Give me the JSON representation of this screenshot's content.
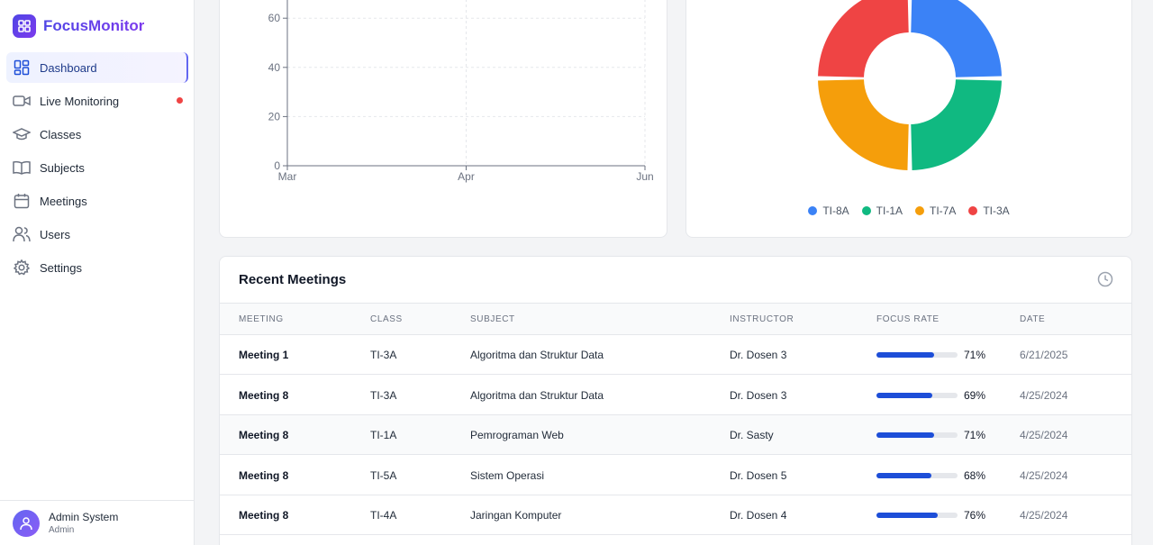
{
  "brand": {
    "name": "FocusMonitor"
  },
  "sidebar": {
    "items": [
      {
        "label": "Dashboard",
        "icon": "dashboard-icon",
        "active": true
      },
      {
        "label": "Live Monitoring",
        "icon": "video-icon",
        "live": true
      },
      {
        "label": "Classes",
        "icon": "graduation-cap-icon"
      },
      {
        "label": "Subjects",
        "icon": "book-icon"
      },
      {
        "label": "Meetings",
        "icon": "calendar-icon"
      },
      {
        "label": "Users",
        "icon": "users-icon"
      },
      {
        "label": "Settings",
        "icon": "gear-icon"
      }
    ],
    "user": {
      "name": "Admin System",
      "role": "Admin"
    }
  },
  "line_chart": {
    "chart_data": {
      "type": "line",
      "x_ticks": [
        "Mar",
        "Apr",
        "Jun"
      ],
      "y_ticks": [
        0,
        20,
        40,
        60
      ],
      "ylim": [
        0,
        80
      ],
      "grid": true,
      "series": []
    }
  },
  "pie_chart": {
    "chart_data": {
      "type": "pie",
      "labels": [
        "TI-8A",
        "TI-1A",
        "TI-7A",
        "TI-3A"
      ],
      "values": [
        25,
        25,
        25,
        25
      ],
      "colors": [
        "#3b82f6",
        "#10b981",
        "#f59e0b",
        "#ef4444"
      ],
      "legend": "bottom"
    }
  },
  "meetings": {
    "title": "Recent Meetings",
    "columns": [
      "MEETING",
      "CLASS",
      "SUBJECT",
      "INSTRUCTOR",
      "FOCUS RATE",
      "DATE"
    ],
    "rows": [
      {
        "meeting": "Meeting 1",
        "class": "TI-3A",
        "subject": "Algoritma dan Struktur Data",
        "instructor": "Dr. Dosen 3",
        "focus": 71,
        "focus_label": "71%",
        "date": "6/21/2025"
      },
      {
        "meeting": "Meeting 8",
        "class": "TI-3A",
        "subject": "Algoritma dan Struktur Data",
        "instructor": "Dr. Dosen 3",
        "focus": 69,
        "focus_label": "69%",
        "date": "4/25/2024"
      },
      {
        "meeting": "Meeting 8",
        "class": "TI-1A",
        "subject": "Pemrograman Web",
        "instructor": "Dr. Sasty",
        "focus": 71,
        "focus_label": "71%",
        "date": "4/25/2024"
      },
      {
        "meeting": "Meeting 8",
        "class": "TI-5A",
        "subject": "Sistem Operasi",
        "instructor": "Dr. Dosen 5",
        "focus": 68,
        "focus_label": "68%",
        "date": "4/25/2024"
      },
      {
        "meeting": "Meeting 8",
        "class": "TI-4A",
        "subject": "Jaringan Komputer",
        "instructor": "Dr. Dosen 4",
        "focus": 76,
        "focus_label": "76%",
        "date": "4/25/2024"
      }
    ]
  }
}
